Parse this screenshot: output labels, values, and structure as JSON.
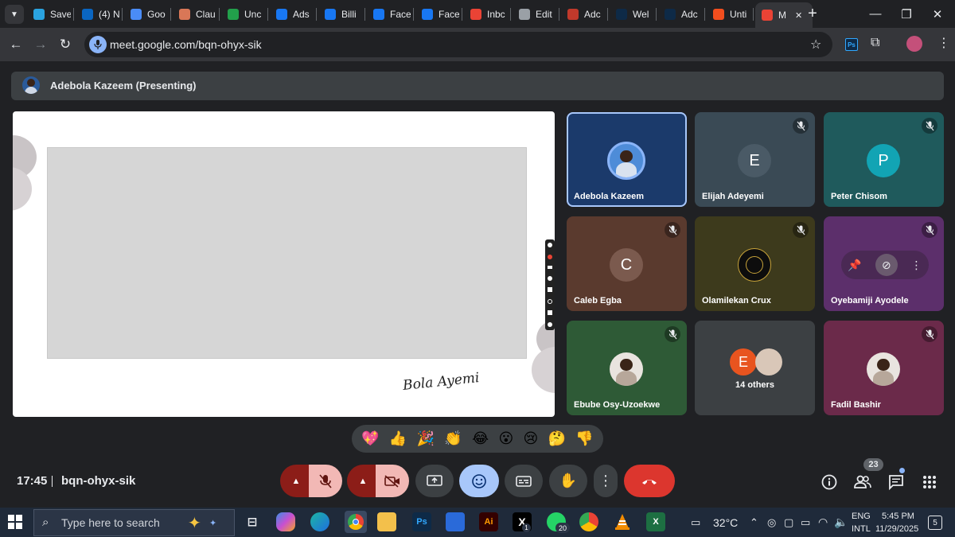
{
  "browser": {
    "tabs": [
      {
        "label": "Save",
        "icon": "telegram-icon",
        "color": "#2aa3e0"
      },
      {
        "label": "(4) N",
        "icon": "linkedin-icon",
        "color": "#0a66c2"
      },
      {
        "label": "Goo",
        "icon": "gemini-icon",
        "color": "#4a8cf7"
      },
      {
        "label": "Clau",
        "icon": "claude-icon",
        "color": "#d97757"
      },
      {
        "label": "Unc",
        "icon": "unsplash-icon",
        "color": "#22a04b"
      },
      {
        "label": "Ads",
        "icon": "meta-icon",
        "color": "#1877f2"
      },
      {
        "label": "Billi",
        "icon": "meta-icon",
        "color": "#1877f2"
      },
      {
        "label": "Face",
        "icon": "facebook-icon",
        "color": "#1877f2"
      },
      {
        "label": "Face",
        "icon": "facebook-icon",
        "color": "#1877f2"
      },
      {
        "label": "Inbc",
        "icon": "gmail-icon",
        "color": "#ea4335"
      },
      {
        "label": "Edit",
        "icon": "globe-icon",
        "color": "#9aa0a6"
      },
      {
        "label": "Adc",
        "icon": "adobe-stock-icon",
        "color": "#c0392b"
      },
      {
        "label": "Wel",
        "icon": "photoshop-icon",
        "color": "#0e2a47"
      },
      {
        "label": "Adc",
        "icon": "photoshop-icon",
        "color": "#0e2a47"
      },
      {
        "label": "Unti",
        "icon": "figma-icon",
        "color": "#f24e1e"
      },
      {
        "label": "M",
        "icon": "recording-icon",
        "color": "#ea4335"
      }
    ],
    "url": "meet.google.com/bqn-ohyx-sik"
  },
  "meet": {
    "presenter_label": "Adebola Kazeem (Presenting)",
    "slide_signature": "Bola Ayemi",
    "participants": [
      {
        "name": "Adebola Kazeem",
        "initial": "",
        "avatar": "photo",
        "muted": false,
        "bg": "#1b3a6b",
        "speaking": true
      },
      {
        "name": "Elijah Adeyemi",
        "initial": "E",
        "avatar": "letter",
        "muted": true,
        "bg": "#3a4a55",
        "avatar_color": "#4a5a66"
      },
      {
        "name": "Peter Chisom",
        "initial": "P",
        "avatar": "letter",
        "muted": true,
        "bg": "#1f5a5c",
        "avatar_color": "#12a4b4"
      },
      {
        "name": "Caleb Egba",
        "initial": "C",
        "avatar": "letter",
        "muted": true,
        "bg": "#5a3a2e",
        "avatar_color": "#7b5a4e"
      },
      {
        "name": "Olamilekan Crux",
        "initial": "",
        "avatar": "logo",
        "muted": true,
        "bg": "#3d3a1c"
      },
      {
        "name": "Oyebamiji Ayodele",
        "initial": "",
        "avatar": "hover-controls",
        "muted": true,
        "bg": "#5c2f6b"
      },
      {
        "name": "Ebube Osy-Uzoekwe",
        "initial": "",
        "avatar": "photo",
        "muted": true,
        "bg": "#2e5a36"
      },
      {
        "name": "14 others",
        "initial": "E",
        "avatar": "group",
        "muted": false,
        "bg": "#3c4043",
        "avatar_color": "#e8541f"
      },
      {
        "name": "Fadil Bashir",
        "initial": "",
        "avatar": "photo",
        "muted": true,
        "bg": "#6b2a4a"
      }
    ],
    "reactions": [
      "💖",
      "👍",
      "🎉",
      "👏",
      "😂",
      "😮",
      "😢",
      "🤔",
      "👎"
    ],
    "time": "17:45",
    "meeting_code": "bqn-ohyx-sik",
    "participant_count": "23"
  },
  "taskbar": {
    "search_placeholder": "Type here to search",
    "weather": "32°C",
    "language": "ENG",
    "layout": "INTL",
    "clock_time": "5:45 PM",
    "clock_date": "11/29/2025",
    "whatsapp_badge": "20",
    "x_badge": "1",
    "notification_count": "5"
  }
}
